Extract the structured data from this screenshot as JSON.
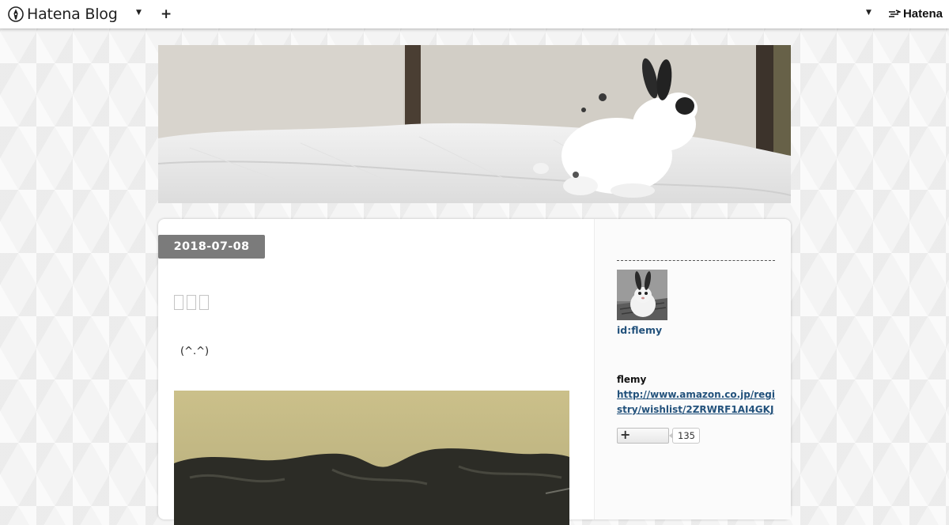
{
  "global_header": {
    "logo_text": "Hatena Blog",
    "logo_icon": "hatena-blog-pen-icon",
    "add_icon": "plus-icon",
    "menu_caret_icon": "caret-down-icon",
    "hatena_text": "Hatena",
    "hatena_icon": "hatena-bird-icon"
  },
  "blog_header": {
    "image": "header-photo-white-rabbit-on-bed"
  },
  "entry": {
    "date": "2018-07-08",
    "title_glyphs": 3,
    "body_text": "(^.^)",
    "photo": "entry-photo-black-bags"
  },
  "sidebar": {
    "profile": {
      "avatar": "rabbit-avatar-photo",
      "id_text": "id:flemy",
      "name": "flemy",
      "url_text": "http://www.amazon.co.jp/registry/wishlist/2ZRWRF1AI4GKJ",
      "follow_icon": "plus-icon",
      "follower_count": "135"
    }
  },
  "colors": {
    "date_badge": "#7b7b7b",
    "link": "#23527c",
    "header_bg": "#ffffff"
  }
}
